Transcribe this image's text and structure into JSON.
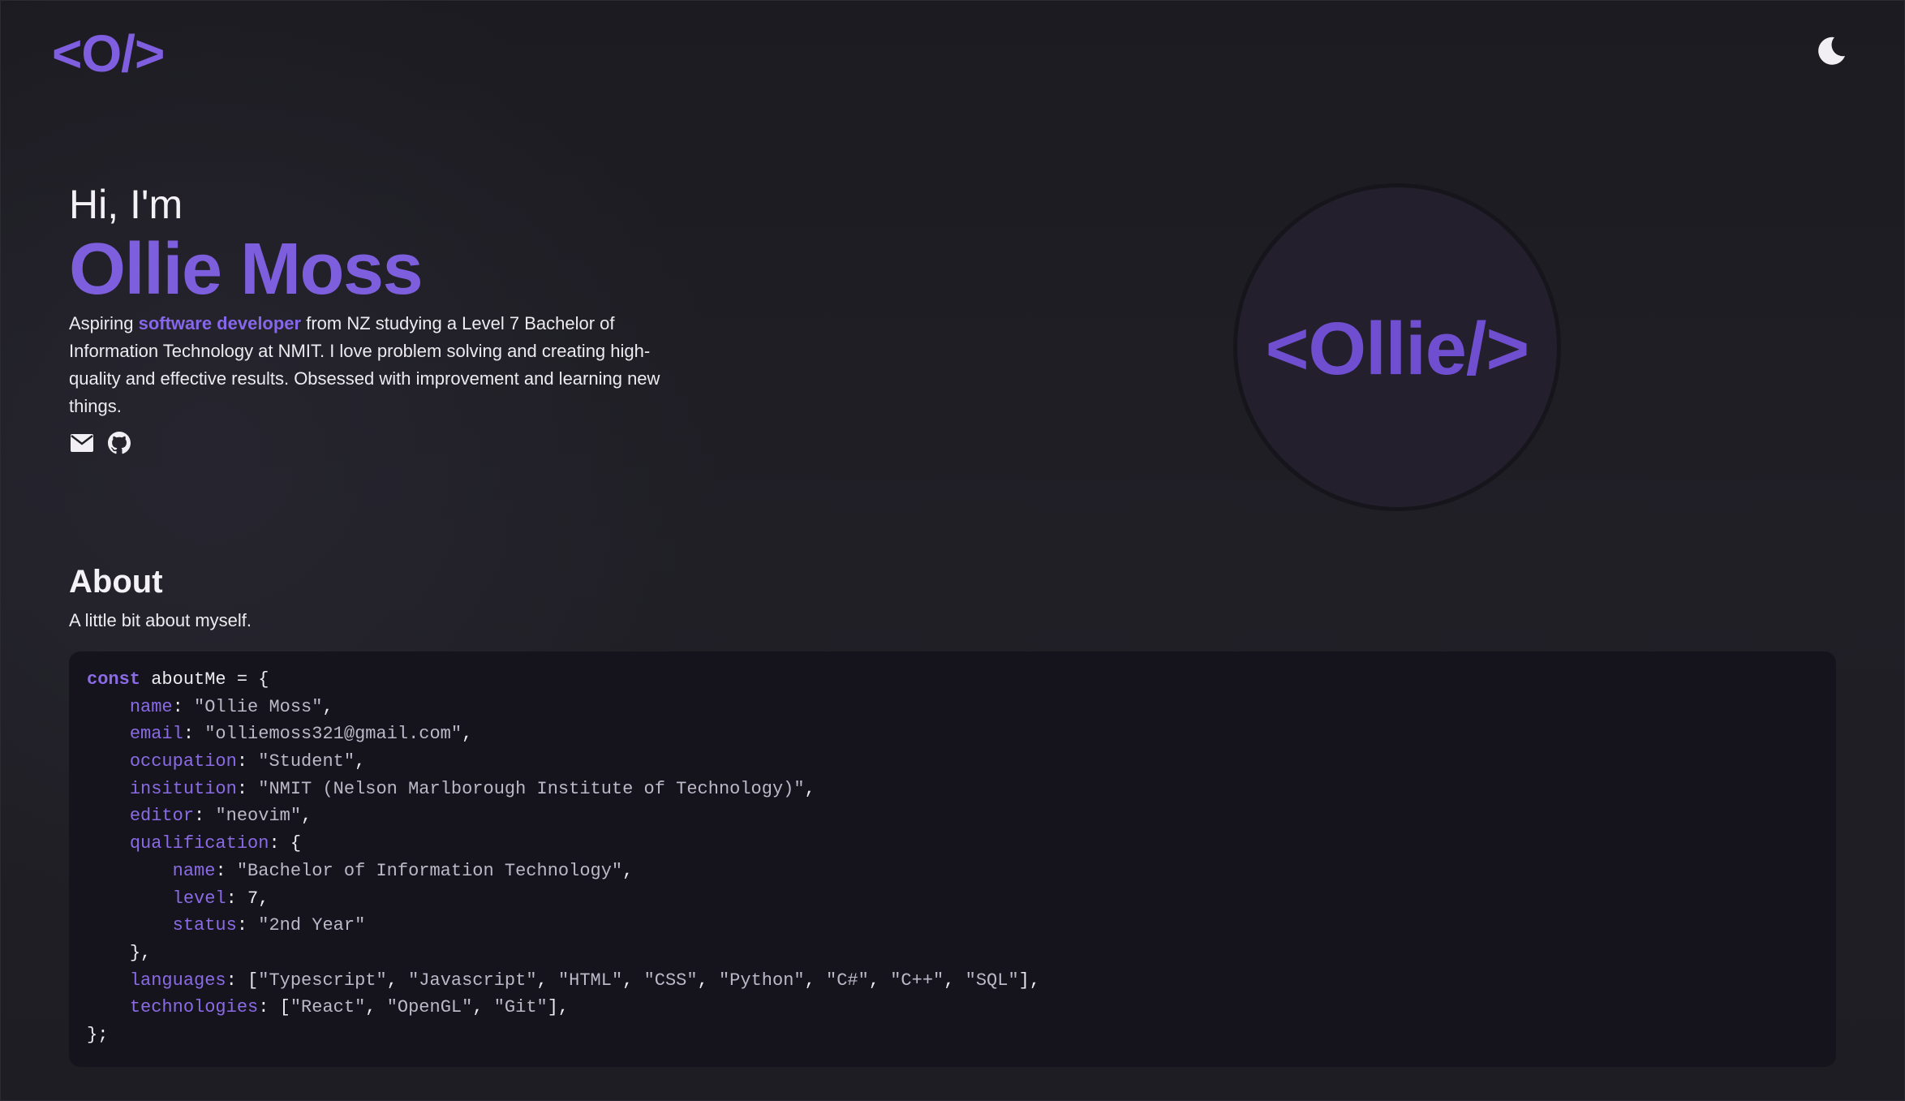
{
  "nav": {
    "logo": "<O/>",
    "theme_toggle_icon": "moon-icon"
  },
  "hero": {
    "greeting": "Hi, I'm",
    "name": "Ollie Moss",
    "intro_prefix": "Aspiring ",
    "intro_highlight": "software developer",
    "intro_suffix": " from NZ studying a Level 7 Bachelor of Information Technology at NMIT. I love problem solving and creating high-quality and effective results. Obsessed with improvement and learning new things.",
    "social_icons": [
      "envelope-icon",
      "github-icon"
    ]
  },
  "avatar": {
    "text": "<Ollie/>"
  },
  "about": {
    "title": "About",
    "subtitle": "A little bit about myself.",
    "code": {
      "keyword": "const",
      "declaration": " aboutMe = {",
      "fields": {
        "name": "\"Ollie Moss\"",
        "email": "\"olliemoss321@gmail.com\"",
        "occupation": "\"Student\"",
        "insitution": "\"NMIT (Nelson Marlborough Institute of Technology)\"",
        "editor": "\"neovim\""
      },
      "qualification_key": "qualification",
      "qualification": {
        "name": "\"Bachelor of Information Technology\"",
        "level": "7",
        "status": "\"2nd Year\""
      },
      "languages": [
        "\"Typescript\"",
        "\"Javascript\"",
        "\"HTML\"",
        "\"CSS\"",
        "\"Python\"",
        "\"C#\"",
        "\"C++\"",
        "\"SQL\""
      ],
      "technologies": [
        "\"React\"",
        "\"OpenGL\"",
        "\"Git\""
      ],
      "closing": "};"
    }
  },
  "colors": {
    "accent": "#7f5ee0",
    "background": "#1f1e24",
    "code_background": "#15141c",
    "avatar_background": "#231f2c"
  }
}
